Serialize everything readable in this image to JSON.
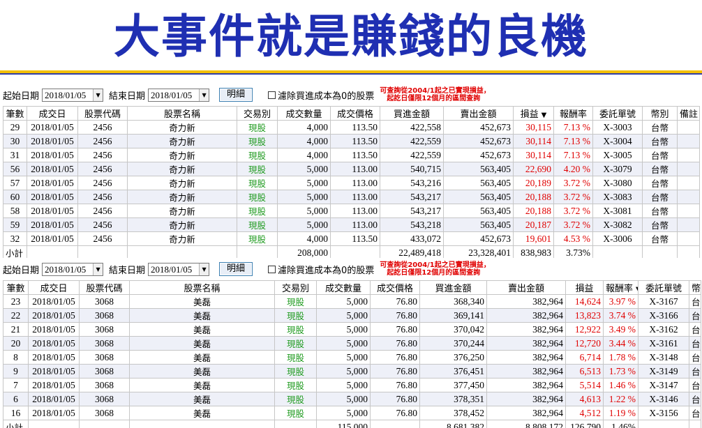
{
  "title": "大事件就是賺錢的良機",
  "panels": [
    {
      "toolbar": {
        "start_label": "起始日期",
        "start_date": "2018/01/05",
        "end_label": "結束日期",
        "end_date": "2018/01/05",
        "detail_button": "明細",
        "filter_checkbox_label": "濾除買進成本為0的股票",
        "note_line1": "可查詢從2004/1起之已實現損益，",
        "note_line2": "起訖日僅限12個月的區間查詢"
      },
      "columns": [
        "筆數",
        "成交日",
        "股票代碼",
        "股票名稱",
        "交易別",
        "成交數量",
        "成交價格",
        "買進金額",
        "賣出金額",
        "損益",
        "報酬率",
        "委託單號",
        "幣別",
        "備註"
      ],
      "sorted_column": "損益",
      "rows": [
        [
          "29",
          "2018/01/05",
          "2456",
          "奇力新",
          "現股",
          "4,000",
          "113.50",
          "422,558",
          "452,673",
          "30,115",
          "7.13 %",
          "X-3003",
          "台幣",
          ""
        ],
        [
          "30",
          "2018/01/05",
          "2456",
          "奇力新",
          "現股",
          "4,000",
          "113.50",
          "422,559",
          "452,673",
          "30,114",
          "7.13 %",
          "X-3004",
          "台幣",
          ""
        ],
        [
          "31",
          "2018/01/05",
          "2456",
          "奇力新",
          "現股",
          "4,000",
          "113.50",
          "422,559",
          "452,673",
          "30,114",
          "7.13 %",
          "X-3005",
          "台幣",
          ""
        ],
        [
          "56",
          "2018/01/05",
          "2456",
          "奇力新",
          "現股",
          "5,000",
          "113.00",
          "540,715",
          "563,405",
          "22,690",
          "4.20 %",
          "X-3079",
          "台幣",
          ""
        ],
        [
          "57",
          "2018/01/05",
          "2456",
          "奇力新",
          "現股",
          "5,000",
          "113.00",
          "543,216",
          "563,405",
          "20,189",
          "3.72 %",
          "X-3080",
          "台幣",
          ""
        ],
        [
          "60",
          "2018/01/05",
          "2456",
          "奇力新",
          "現股",
          "5,000",
          "113.00",
          "543,217",
          "563,405",
          "20,188",
          "3.72 %",
          "X-3083",
          "台幣",
          ""
        ],
        [
          "58",
          "2018/01/05",
          "2456",
          "奇力新",
          "現股",
          "5,000",
          "113.00",
          "543,217",
          "563,405",
          "20,188",
          "3.72 %",
          "X-3081",
          "台幣",
          ""
        ],
        [
          "59",
          "2018/01/05",
          "2456",
          "奇力新",
          "現股",
          "5,000",
          "113.00",
          "543,218",
          "563,405",
          "20,187",
          "3.72 %",
          "X-3082",
          "台幣",
          ""
        ],
        [
          "32",
          "2018/01/05",
          "2456",
          "奇力新",
          "現股",
          "4,000",
          "113.50",
          "433,072",
          "452,673",
          "19,601",
          "4.53 %",
          "X-3006",
          "台幣",
          ""
        ]
      ],
      "subtotal": {
        "label": "小計",
        "quantity": "208,000",
        "buy_amount": "22,489,418",
        "sell_amount": "23,328,401",
        "profit": "838,983",
        "return": "3.73%"
      }
    },
    {
      "toolbar": {
        "start_label": "起始日期",
        "start_date": "2018/01/05",
        "end_label": "結束日期",
        "end_date": "2018/01/05",
        "detail_button": "明細",
        "filter_checkbox_label": "濾除買進成本為0的股票",
        "note_line1": "可查詢從2004/1起之已實現損益，",
        "note_line2": "起訖日僅限12個月的區間查詢"
      },
      "columns": [
        "筆數",
        "成交日",
        "股票代碼",
        "股票名稱",
        "交易別",
        "成交數量",
        "成交價格",
        "買進金額",
        "賣出金額",
        "損益",
        "報酬率",
        "委託單號",
        "幣別"
      ],
      "sorted_column": "報酬率",
      "rows": [
        [
          "23",
          "2018/01/05",
          "3068",
          "美磊",
          "現股",
          "5,000",
          "76.80",
          "368,340",
          "382,964",
          "14,624",
          "3.97 %",
          "X-3167",
          "台幣"
        ],
        [
          "22",
          "2018/01/05",
          "3068",
          "美磊",
          "現股",
          "5,000",
          "76.80",
          "369,141",
          "382,964",
          "13,823",
          "3.74 %",
          "X-3166",
          "台幣"
        ],
        [
          "21",
          "2018/01/05",
          "3068",
          "美磊",
          "現股",
          "5,000",
          "76.80",
          "370,042",
          "382,964",
          "12,922",
          "3.49 %",
          "X-3162",
          "台幣"
        ],
        [
          "20",
          "2018/01/05",
          "3068",
          "美磊",
          "現股",
          "5,000",
          "76.80",
          "370,244",
          "382,964",
          "12,720",
          "3.44 %",
          "X-3161",
          "台幣"
        ],
        [
          "8",
          "2018/01/05",
          "3068",
          "美磊",
          "現股",
          "5,000",
          "76.80",
          "376,250",
          "382,964",
          "6,714",
          "1.78 %",
          "X-3148",
          "台幣"
        ],
        [
          "9",
          "2018/01/05",
          "3068",
          "美磊",
          "現股",
          "5,000",
          "76.80",
          "376,451",
          "382,964",
          "6,513",
          "1.73 %",
          "X-3149",
          "台幣"
        ],
        [
          "7",
          "2018/01/05",
          "3068",
          "美磊",
          "現股",
          "5,000",
          "76.80",
          "377,450",
          "382,964",
          "5,514",
          "1.46 %",
          "X-3147",
          "台幣"
        ],
        [
          "6",
          "2018/01/05",
          "3068",
          "美磊",
          "現股",
          "5,000",
          "76.80",
          "378,351",
          "382,964",
          "4,613",
          "1.22 %",
          "X-3146",
          "台幣"
        ],
        [
          "16",
          "2018/01/05",
          "3068",
          "美磊",
          "現股",
          "5,000",
          "76.80",
          "378,452",
          "382,964",
          "4,512",
          "1.19 %",
          "X-3156",
          "台幣"
        ]
      ],
      "subtotal": {
        "label": "小計",
        "quantity": "115,000",
        "buy_amount": "8,681,382",
        "sell_amount": "8,808,172",
        "profit": "126,790",
        "return": "1.46%"
      }
    }
  ]
}
